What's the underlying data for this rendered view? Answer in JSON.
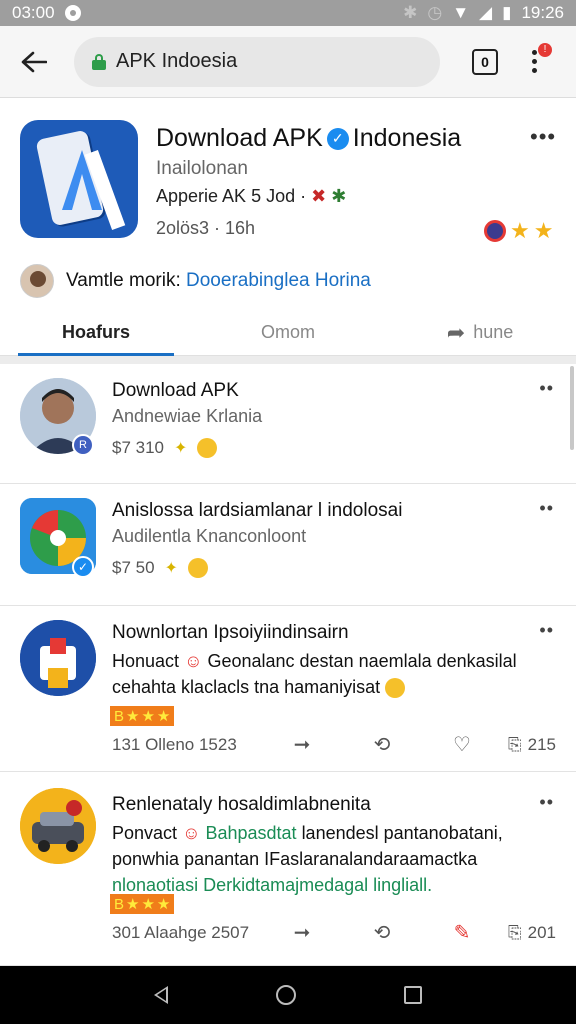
{
  "status_bar": {
    "time_left": "03:00",
    "time_right": "19:26"
  },
  "url_bar": {
    "url": "APK Indoesia",
    "tab_count": "0",
    "menu_badge": "!"
  },
  "app": {
    "title": "Download APK",
    "title_suffix": "Indonesia",
    "subtitle": "Inailolonan",
    "subtitle2": "Apperie AK 5 Jod ·",
    "meta": "2olös3 · 16h",
    "developer_label": "Vamtle morik:",
    "developer_link": "Dooerabinglea Horina"
  },
  "tabs": [
    {
      "label": "Hoafurs",
      "active": true
    },
    {
      "label": "Omom",
      "active": false
    },
    {
      "label": "hune",
      "active": false
    }
  ],
  "posts": [
    {
      "title": "Download APK",
      "subtitle": "Andnewiae Krlania",
      "meta": "$7 310"
    },
    {
      "title": "Anislossa lardsiamlanar l indolosai",
      "subtitle": "Audilentla Knanconloont",
      "meta": "$7 50"
    },
    {
      "title": "Nownlortan Ipsoiyiindinsairn",
      "body_line1": "Honuact",
      "body_line1b": "Geonalanc destan naemlala denkasilal",
      "body_line2": "cehahta klaclacls tna hamaniyisat",
      "stars_label": "B",
      "time": "131 Olleno 1523",
      "share_count": "215"
    },
    {
      "title": "Renlenataly hosaldimlabnenita",
      "body_line1": "Ponvact",
      "body_hl": "Bahpasdtat",
      "body_line1b": "lanendesl pantanobatani,",
      "body_line2": "ponwhia panantan IFaslaranalandaraamactka",
      "body_line3": "nlonaotiasi Derkidtamajmedagal lingliall.",
      "stars_label": "B",
      "time": "301 Alaahge 2507",
      "share_count": "201"
    }
  ],
  "colors": {
    "accent": "#1a6fc4",
    "verified": "#1a8cf0",
    "star": "#f3b31b",
    "badge": "#f07d1a"
  }
}
